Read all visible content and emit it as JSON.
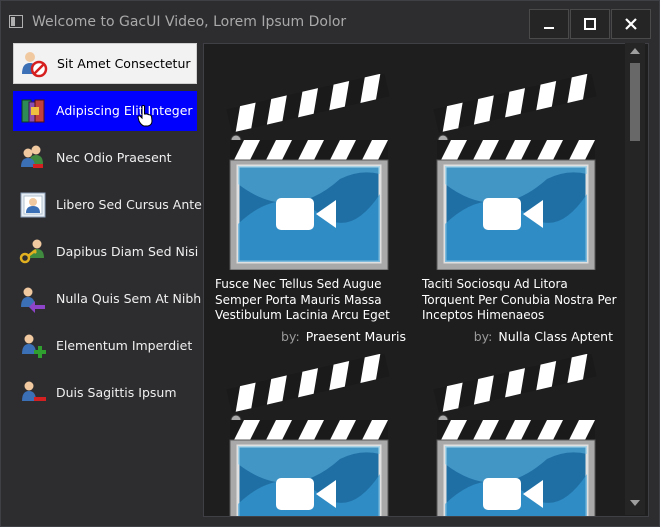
{
  "window": {
    "title": "Welcome to GacUI Video, Lorem Ipsum Dolor",
    "minimize_icon": "minimize-icon",
    "maximize_icon": "maximize-icon",
    "close_icon": "close-icon"
  },
  "sidebar": {
    "items": [
      {
        "label": "Sit Amet Consectetur",
        "icon": "user-forbidden-icon",
        "state": "selected"
      },
      {
        "label": "Adipiscing Elit Integer",
        "icon": "books-icon",
        "state": "hovered"
      },
      {
        "label": "Nec Odio Praesent",
        "icon": "users-remove-icon",
        "state": "normal"
      },
      {
        "label": "Libero Sed Cursus Ante",
        "icon": "user-card-icon",
        "state": "normal"
      },
      {
        "label": "Dapibus Diam Sed Nisi",
        "icon": "users-key-icon",
        "state": "normal"
      },
      {
        "label": "Nulla Quis Sem At Nibh",
        "icon": "user-arrow-icon",
        "state": "normal"
      },
      {
        "label": "Elementum Imperdiet",
        "icon": "user-add-icon",
        "state": "normal"
      },
      {
        "label": "Duis Sagittis Ipsum",
        "icon": "user-remove-icon",
        "state": "normal"
      }
    ]
  },
  "videos": [
    {
      "title": "Fusce Nec Tellus Sed Augue Semper Porta Mauris Massa Vestibulum Lacinia Arcu Eget",
      "by_label": "by:",
      "author": "Praesent Mauris",
      "icon": "video-clapperboard-icon"
    },
    {
      "title": "Taciti Sociosqu Ad Litora Torquent Per Conubia Nostra Per Inceptos Himenaeos",
      "by_label": "by:",
      "author": "Nulla Class Aptent",
      "icon": "video-clapperboard-icon"
    },
    {
      "title": "",
      "by_label": "",
      "author": "",
      "icon": "video-clapperboard-icon"
    },
    {
      "title": "",
      "by_label": "",
      "author": "",
      "icon": "video-clapperboard-icon"
    }
  ],
  "colors": {
    "window_bg": "#2d2d30",
    "content_bg": "#1e1e1e",
    "hover_bg": "#0000ff",
    "selected_bg": "#f2f2f2"
  }
}
